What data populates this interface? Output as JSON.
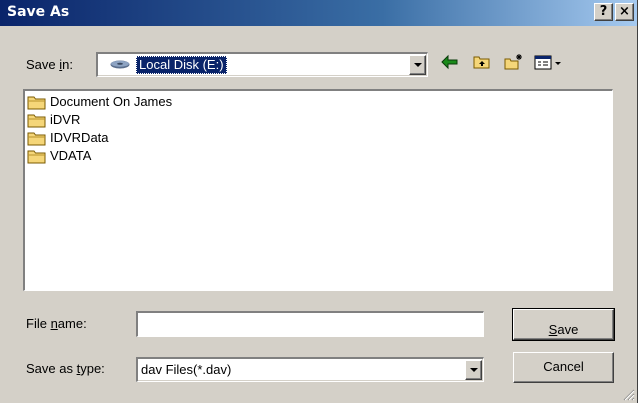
{
  "window": {
    "title": "Save As",
    "help_label": "?",
    "close_label": "×"
  },
  "lookin": {
    "label_pre": "Save ",
    "label_u": "i",
    "label_post": "n:",
    "value": "Local Disk (E:)",
    "icon": "hard-disk-icon"
  },
  "toolbar": {
    "back_icon": "back-arrow-icon",
    "up_icon": "up-folder-icon",
    "new_folder_icon": "new-folder-icon",
    "views_icon": "views-menu-icon"
  },
  "files": [
    {
      "name": "Document On James",
      "icon": "folder-icon"
    },
    {
      "name": "iDVR",
      "icon": "folder-icon"
    },
    {
      "name": "IDVRData",
      "icon": "folder-icon"
    },
    {
      "name": "VDATA",
      "icon": "folder-icon"
    }
  ],
  "filename": {
    "label_pre": "File ",
    "label_u": "n",
    "label_post": "ame:",
    "value": ""
  },
  "filetype": {
    "label_pre": "Save as ",
    "label_u": "t",
    "label_post": "ype:",
    "value": "dav Files(*.dav)"
  },
  "buttons": {
    "save_u": "S",
    "save_rest": "ave",
    "cancel": "Cancel"
  },
  "colors": {
    "titlebar_start": "#0a246a",
    "titlebar_end": "#a6caf0",
    "face": "#d4d0c8",
    "folder": "#f5d679"
  }
}
